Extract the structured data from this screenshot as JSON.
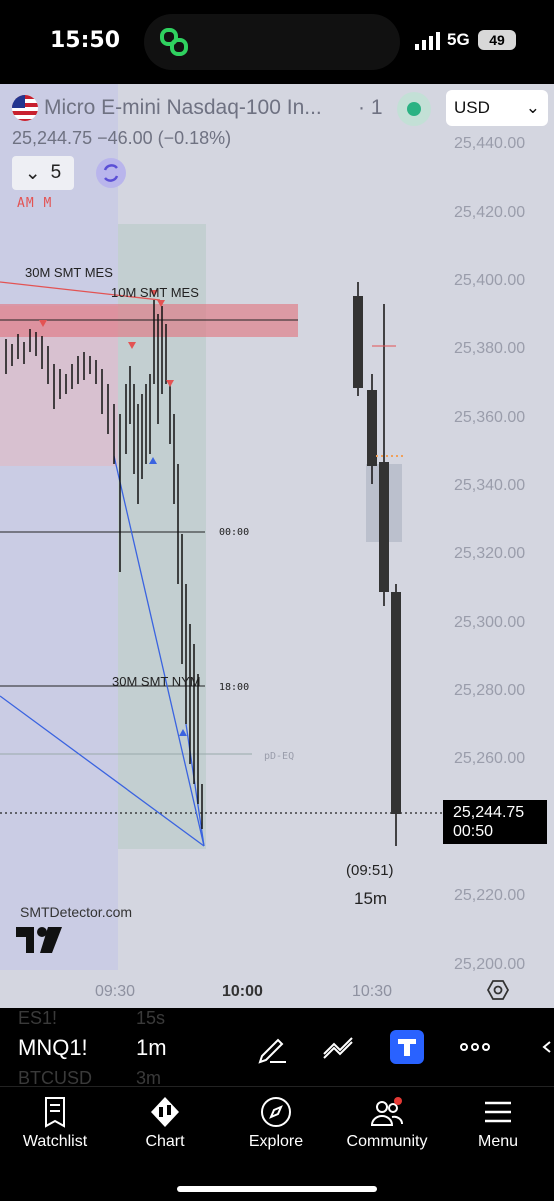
{
  "status_bar": {
    "time": "15:50",
    "network": "5G",
    "battery": "49"
  },
  "chart": {
    "symbol_name": "Micro E-mini Nasdaq-100 In...",
    "symbol_dot": "· 1",
    "currency": "USD",
    "price_line": "25,244.75  −46.00 (−0.18%)",
    "collapse_count": "5",
    "session_tag": "AM M",
    "y_axis": [
      "25,440.00",
      "25,420.00",
      "25,400.00",
      "25,380.00",
      "25,360.00",
      "25,340.00",
      "25,320.00",
      "25,300.00",
      "25,280.00",
      "25,260.00",
      "25,220.00",
      "25,200.00"
    ],
    "x_axis": [
      "09:30",
      "10:00",
      "10:30"
    ],
    "annotations": {
      "smt_30m_mes": "30M SMT MES",
      "smt_10m_mes": "10M SMT MES",
      "smt_30m_nym": "30M SMT NYM",
      "time_0000": "00:00",
      "time_1800": "18:00",
      "pd_eq": "pD-EQ"
    },
    "last_price": "25,244.75",
    "countdown": "00:50",
    "candle_time": "(09:51)",
    "candle_interval": "15m",
    "watermark": "SMTDetector.com"
  },
  "toolbar": {
    "symbol": "MNQ1!",
    "interval": "1m",
    "ghost_prev_symbol": "ES1!",
    "ghost_prev_interval": "15s",
    "ghost_next_symbol": "BTCUSD",
    "ghost_next_interval": "3m"
  },
  "nav": [
    {
      "label": "Watchlist",
      "icon": "watchlist-icon"
    },
    {
      "label": "Chart",
      "icon": "chart-icon"
    },
    {
      "label": "Explore",
      "icon": "compass-icon"
    },
    {
      "label": "Community",
      "icon": "community-icon"
    },
    {
      "label": "Menu",
      "icon": "menu-icon"
    }
  ]
}
